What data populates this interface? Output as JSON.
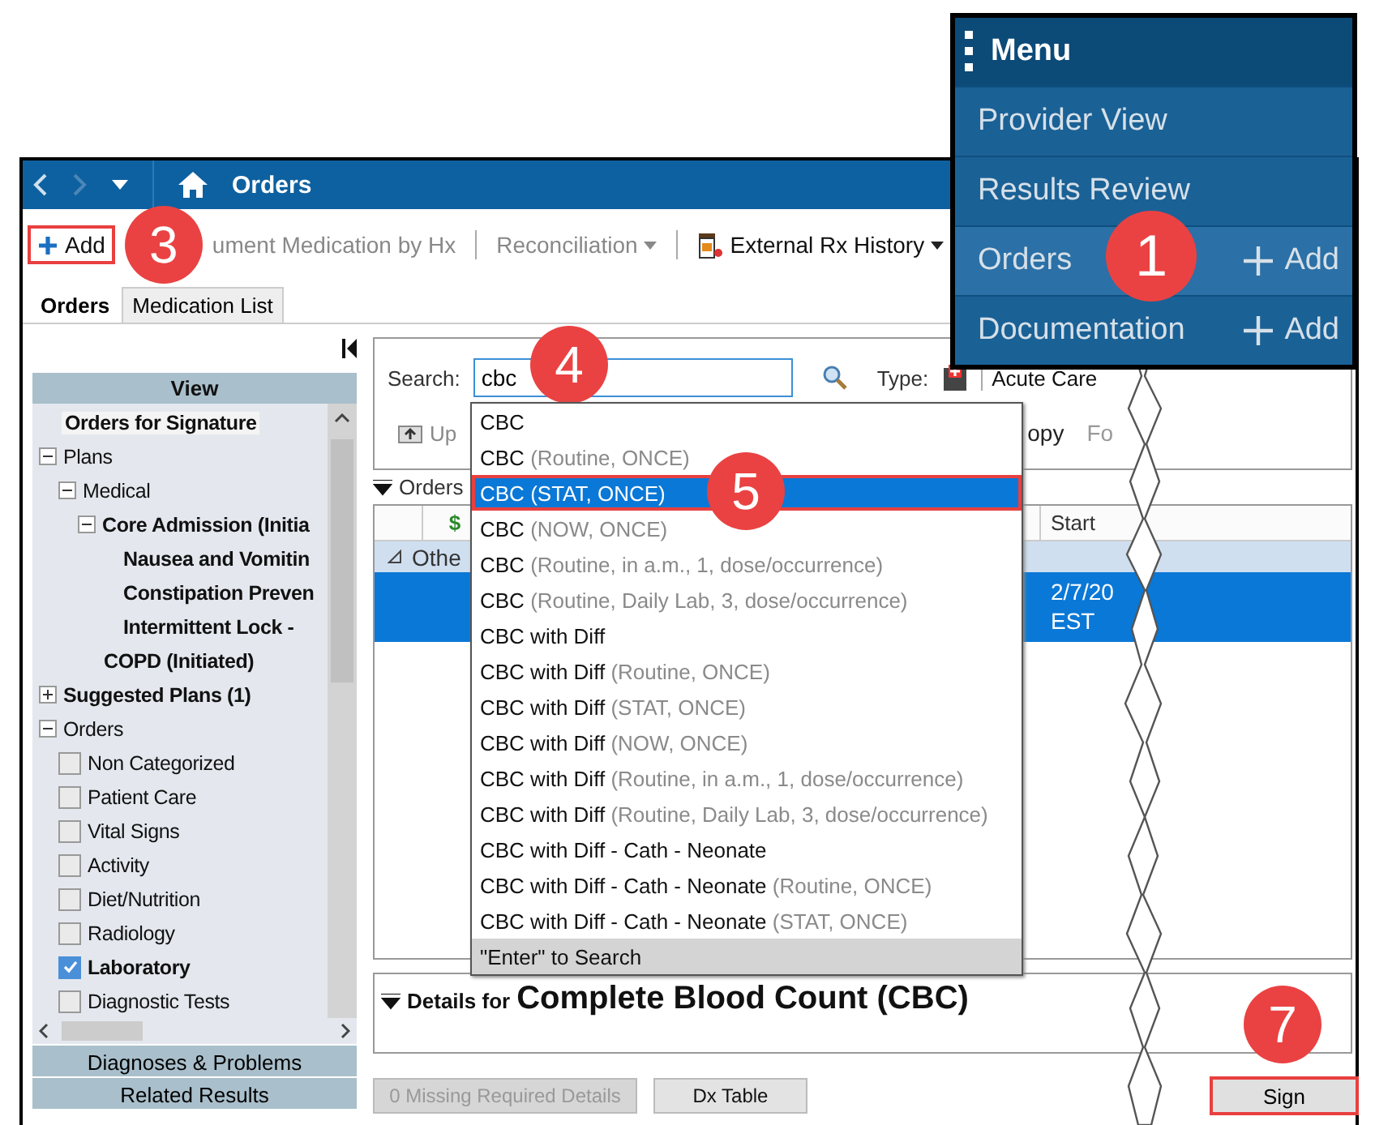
{
  "menu": {
    "title": "Menu",
    "items": [
      {
        "label": "Provider View",
        "selected": false
      },
      {
        "label": "Results Review",
        "selected": false
      },
      {
        "label": "Orders",
        "selected": true,
        "add": "Add",
        "badge": "1"
      },
      {
        "label": "Documentation",
        "selected": false,
        "add": "Add"
      }
    ]
  },
  "window": {
    "title": "Orders"
  },
  "toolbar": [
    {
      "kind": "add",
      "label": "Add",
      "disabled": false,
      "highlighted": true,
      "badge": "3"
    },
    {
      "kind": "text",
      "label": "ument Medication by Hx",
      "disabled": true,
      "highlighted": false
    },
    {
      "kind": "dropdown",
      "label": "Reconciliation",
      "disabled": true,
      "highlighted": false
    },
    {
      "kind": "rx",
      "label": "External Rx History",
      "disabled": false,
      "highlighted": false
    }
  ],
  "tabs": [
    {
      "label": "Orders",
      "selected": true
    },
    {
      "label": "Medication List",
      "selected": false
    }
  ],
  "view_panel": {
    "title": "View",
    "tree": [
      {
        "label": "Orders for Signature",
        "bold": true,
        "selected": true
      },
      {
        "label": "Plans",
        "bold": false,
        "selected": false,
        "expanded": true,
        "children": [
          {
            "label": "Medical",
            "bold": false,
            "selected": false,
            "expanded": true,
            "children": [
              {
                "label": "Core Admission (Initia",
                "bold": true,
                "selected": false,
                "expanded": true,
                "children": [
                  {
                    "label": "Nausea and Vomitin",
                    "bold": true,
                    "selected": false
                  },
                  {
                    "label": "Constipation Preven",
                    "bold": true,
                    "selected": false
                  },
                  {
                    "label": "Intermittent Lock -",
                    "bold": true,
                    "selected": false
                  }
                ]
              },
              {
                "label": "COPD (Initiated)",
                "bold": true,
                "selected": false
              }
            ]
          }
        ]
      },
      {
        "label": "Suggested Plans (1)",
        "bold": true,
        "selected": false,
        "expanded": false
      },
      {
        "label": "Orders",
        "bold": false,
        "selected": false,
        "expanded": true,
        "children": [
          {
            "kind": "checkbox",
            "label": "Non Categorized",
            "bold": false,
            "selected": false,
            "checked": false
          },
          {
            "kind": "checkbox",
            "label": "Patient Care",
            "bold": false,
            "selected": false,
            "checked": false
          },
          {
            "kind": "checkbox",
            "label": "Vital Signs",
            "bold": false,
            "selected": false,
            "checked": false
          },
          {
            "kind": "checkbox",
            "label": "Activity",
            "bold": false,
            "selected": false,
            "checked": false
          },
          {
            "kind": "checkbox",
            "label": "Diet/Nutrition",
            "bold": false,
            "selected": false,
            "checked": false
          },
          {
            "kind": "checkbox",
            "label": "Radiology",
            "bold": false,
            "selected": false,
            "checked": false
          },
          {
            "kind": "checkbox",
            "label": "Laboratory",
            "bold": true,
            "selected": false,
            "checked": true
          },
          {
            "kind": "checkbox",
            "label": "Diagnostic Tests",
            "bold": false,
            "selected": false,
            "checked": false
          }
        ]
      }
    ],
    "sections": [
      "Diagnoses & Problems",
      "Related Results"
    ]
  },
  "search": {
    "label": "Search:",
    "value": "cbc",
    "badge": "4",
    "type_label": "Type:",
    "type_value": "Acute Care",
    "actions": [
      "Up",
      "opy",
      "Fo"
    ]
  },
  "orders_section": {
    "title": "Orders"
  },
  "table": {
    "columns": [
      "$",
      "Start"
    ],
    "group": "Othe",
    "rows": [
      {
        "selected": true,
        "start": "2/7/20\nEST"
      }
    ]
  },
  "dropdown": {
    "items": [
      {
        "name": "CBC",
        "selected": false
      },
      {
        "name": "CBC",
        "detail": "(Routine, ONCE)",
        "selected": false
      },
      {
        "name": "CBC",
        "detail": "(STAT, ONCE)",
        "selected": true,
        "highlighted": true,
        "badge": "5"
      },
      {
        "name": "CBC",
        "detail": "(NOW, ONCE)",
        "selected": false
      },
      {
        "name": "CBC",
        "detail": "(Routine, in a.m., 1, dose/occurrence)",
        "selected": false
      },
      {
        "name": "CBC",
        "detail": "(Routine, Daily Lab, 3, dose/occurrence)",
        "selected": false
      },
      {
        "name": "CBC with Diff",
        "selected": false
      },
      {
        "name": "CBC with Diff",
        "detail": "(Routine, ONCE)",
        "selected": false
      },
      {
        "name": "CBC with Diff",
        "detail": "(STAT, ONCE)",
        "selected": false
      },
      {
        "name": "CBC with Diff",
        "detail": "(NOW, ONCE)",
        "selected": false
      },
      {
        "name": "CBC with Diff",
        "detail": "(Routine, in a.m., 1, dose/occurrence)",
        "selected": false
      },
      {
        "name": "CBC with Diff",
        "detail": "(Routine, Daily Lab, 3, dose/occurrence)",
        "selected": false
      },
      {
        "name": "CBC with Diff - Cath - Neonate",
        "selected": false
      },
      {
        "name": "CBC with Diff - Cath - Neonate",
        "detail": "(Routine, ONCE)",
        "selected": false
      },
      {
        "name": "CBC with Diff - Cath - Neonate",
        "detail": "(STAT, ONCE)",
        "selected": false
      }
    ],
    "footer": "\"Enter\" to Search"
  },
  "details": {
    "prefix": "Details for",
    "title": "Complete Blood Count (CBC)"
  },
  "footer_buttons": [
    {
      "label": "0 Missing Required Details",
      "disabled": true
    },
    {
      "label": "Dx Table",
      "disabled": false
    }
  ],
  "sign_button": {
    "label": "Sign",
    "highlighted": true,
    "badge": "7"
  }
}
